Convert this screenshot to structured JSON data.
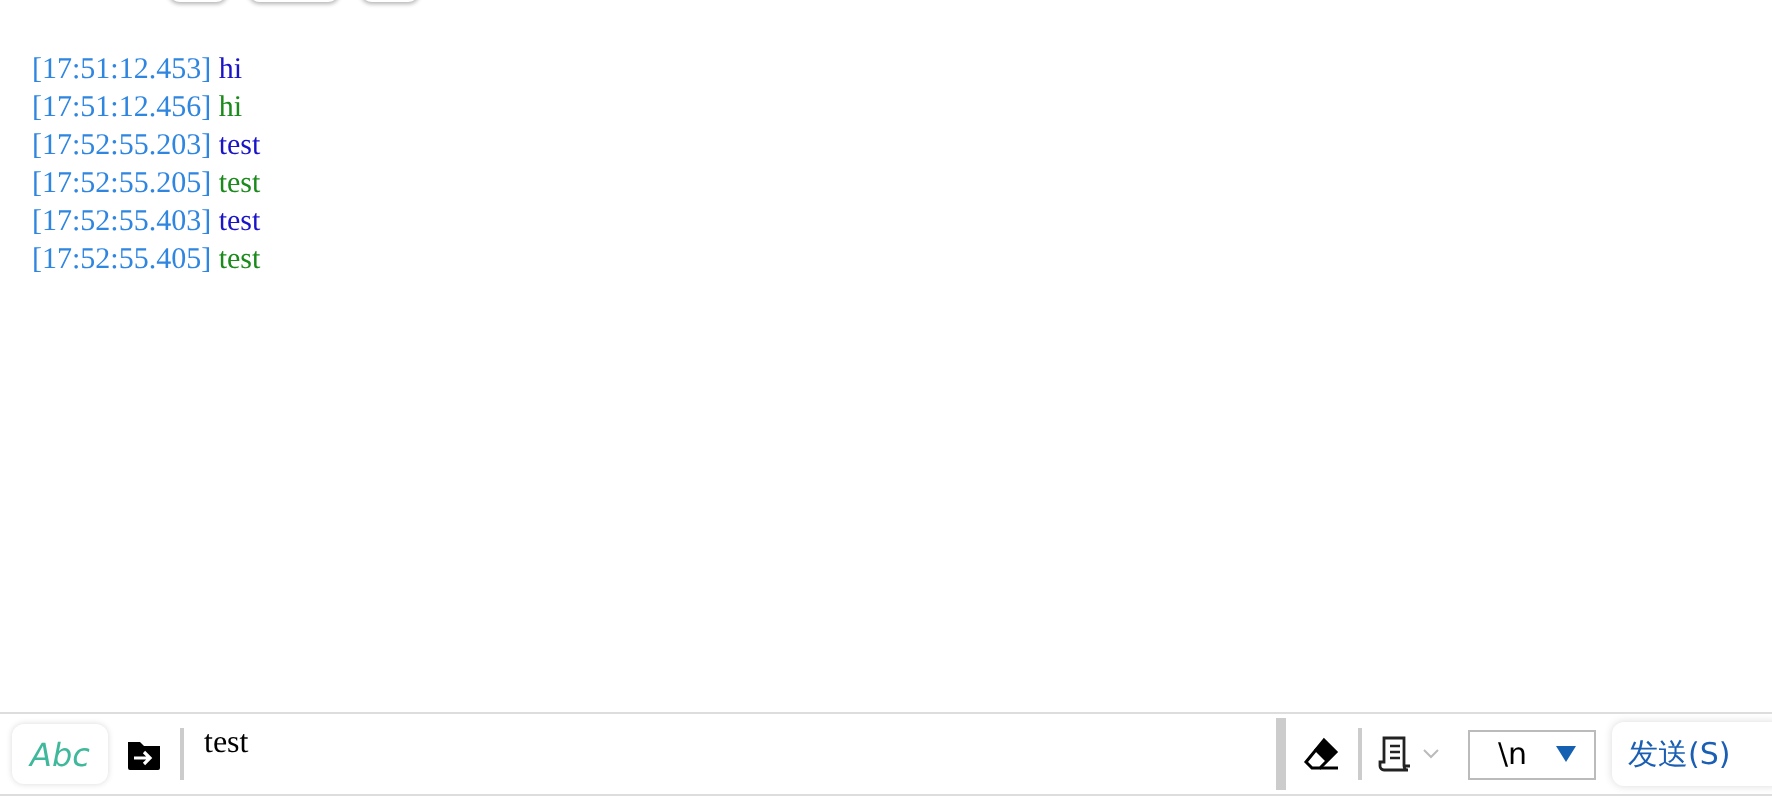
{
  "log": [
    {
      "time": "[17:51:12.453]",
      "text": "hi",
      "kind": "sent"
    },
    {
      "time": "[17:51:12.456]",
      "text": "hi",
      "kind": "received"
    },
    {
      "time": "[17:52:55.203]",
      "text": "test",
      "kind": "sent"
    },
    {
      "time": "[17:52:55.205]",
      "text": "test",
      "kind": "received"
    },
    {
      "time": "[17:52:55.403]",
      "text": "test",
      "kind": "sent"
    },
    {
      "time": "[17:52:55.405]",
      "text": "test",
      "kind": "received"
    }
  ],
  "input": {
    "mode_label": "Abc",
    "value": "test"
  },
  "line_ending": "\\n",
  "send_button": "发送(S)"
}
